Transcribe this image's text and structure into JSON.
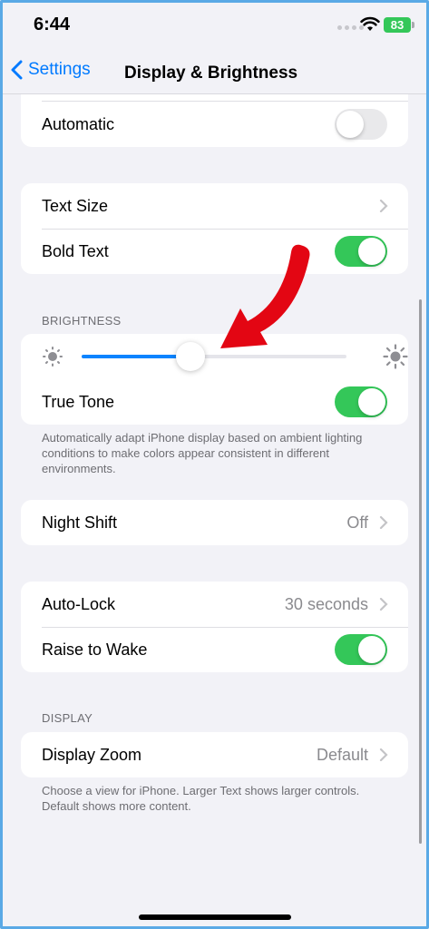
{
  "status_bar": {
    "time": "6:44",
    "battery": "83"
  },
  "nav": {
    "back_label": "Settings",
    "title": "Display & Brightness"
  },
  "appearance_group": {
    "automatic_label": "Automatic",
    "automatic_on": false
  },
  "text_group": {
    "text_size_label": "Text Size",
    "bold_text_label": "Bold Text",
    "bold_text_on": true
  },
  "brightness": {
    "header": "BRIGHTNESS",
    "level": 0.41,
    "true_tone_label": "True Tone",
    "true_tone_on": true,
    "footnote": "Automatically adapt iPhone display based on ambient lighting conditions to make colors appear consistent in different environments."
  },
  "night_shift": {
    "label": "Night Shift",
    "value": "Off"
  },
  "lock_group": {
    "auto_lock_label": "Auto-Lock",
    "auto_lock_value": "30 seconds",
    "raise_to_wake_label": "Raise to Wake",
    "raise_to_wake_on": true
  },
  "display": {
    "header": "DISPLAY",
    "zoom_label": "Display Zoom",
    "zoom_value": "Default",
    "footnote": "Choose a view for iPhone. Larger Text shows larger controls. Default shows more content."
  },
  "colors": {
    "accent": "#007aff",
    "toggle_on": "#34c759",
    "slider_fill": "#0a84ff",
    "annotation_arrow": "#e30613"
  },
  "icons": [
    "chevron-left-icon",
    "chevron-right-icon",
    "sun-small-icon",
    "sun-large-icon",
    "wifi-icon",
    "battery-icon",
    "annotation-arrow-icon"
  ]
}
